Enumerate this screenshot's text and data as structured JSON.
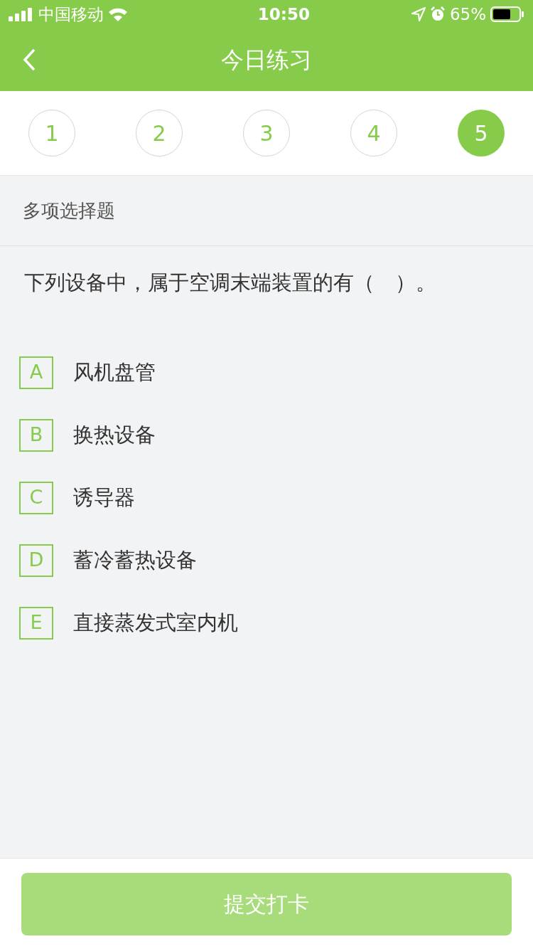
{
  "status_bar": {
    "carrier": "中国移动",
    "time": "10:50",
    "battery": "65%"
  },
  "nav": {
    "title": "今日练习"
  },
  "question_tabs": [
    {
      "label": "1",
      "selected": false
    },
    {
      "label": "2",
      "selected": false
    },
    {
      "label": "3",
      "selected": false
    },
    {
      "label": "4",
      "selected": false
    },
    {
      "label": "5",
      "selected": true
    }
  ],
  "section": {
    "title": "多项选择题"
  },
  "question": {
    "text": "下列设备中，属于空调末端装置的有（　）。"
  },
  "options": [
    {
      "letter": "A",
      "text": "风机盘管",
      "selected": false
    },
    {
      "letter": "B",
      "text": "换热设备",
      "selected": false
    },
    {
      "letter": "C",
      "text": "诱导器",
      "selected": false
    },
    {
      "letter": "D",
      "text": "蓄冷蓄热设备",
      "selected": false
    },
    {
      "letter": "E",
      "text": "直接蒸发式室内机",
      "selected": false
    }
  ],
  "submit": {
    "label": "提交打卡",
    "disabled": true
  }
}
